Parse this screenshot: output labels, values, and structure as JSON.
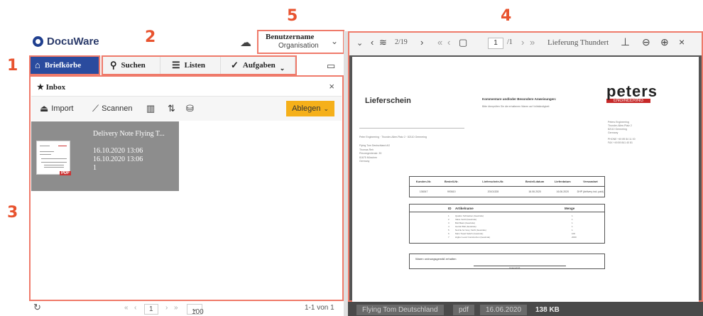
{
  "callouts": [
    "1",
    "2",
    "3",
    "4",
    "5"
  ],
  "app": {
    "logo_text": "DocuWare"
  },
  "user": {
    "name": "Benutzername",
    "org": "Organisation"
  },
  "nav": [
    {
      "label": "Briefkörbe",
      "icon": "inbox-tray-icon"
    },
    {
      "label": "Suchen",
      "icon": "search-icon"
    },
    {
      "label": "Listen",
      "icon": "list-icon"
    },
    {
      "label": "Aufgaben",
      "icon": "check-icon"
    }
  ],
  "inbox": {
    "title": "Inbox",
    "toolbar": {
      "import": "Import",
      "scan": "Scannen",
      "file_button": "Ablegen"
    },
    "card": {
      "title": "Delivery Note Flying T...",
      "date1": "16.10.2020 13:06",
      "date2": "16.10.2020 13:06",
      "count": "1",
      "badge": "PDF"
    }
  },
  "pager": {
    "page": "1",
    "per_page": "100",
    "range": "1-1 von 1"
  },
  "viewer": {
    "doc_index": "2/19",
    "page": "1",
    "page_total": "/1",
    "doc_title": "Lieferung Thundert",
    "document": {
      "heading": "Lieferschein",
      "comments": "Kommentare und/oder Besondere Anweisungen:",
      "comments_sub": "Bitte überprüfen Sie die erhaltenen Waren auf Vollständigkeit",
      "brand": "peters",
      "brand_sub": "ENGINEERING",
      "sender_line": "Peter Engineering · Thunder-Allee-Platz 2 · 82110 Germering",
      "recipient": [
        "Flying Tom Deutschland AG",
        "Thomas Reh",
        "Prinzregentenstr. 39",
        "81675 München",
        "Germany"
      ],
      "company": [
        "Peters Engineering",
        "Thunder-Allee-Platz 2",
        "82110 Germering",
        "Germany"
      ],
      "contact": [
        "PHONE  +49 89 84 11 00",
        "FAX    +49 89 841 40 81"
      ],
      "table1_headers": [
        "Kunden-Nr.",
        "Bestell-Nr.",
        "Lieferschein-Nr.",
        "Bestell-datum",
        "Lieferdatum",
        "Versandart"
      ],
      "table1_row": [
        "136347",
        "993610",
        "20101328",
        "16.06.2020",
        "16.06.2020",
        "DHP (delivery incl. paid)"
      ],
      "table2_headers": [
        "ID",
        "Artikelname",
        "Menge"
      ],
      "table2_rows": [
        [
          "1",
          "Quattro Schrauben (Gewinde)",
          "1"
        ],
        [
          "2",
          "Valve Ventil (Gewinde)",
          "1"
        ],
        [
          "3",
          "Bolt Basic (Gewinde)",
          "1"
        ],
        [
          "4",
          "Gerüst Bolt (Gewinde)",
          "1"
        ],
        [
          "5",
          "Nozzle for Grey Yacht (Gewinde)",
          "1"
        ],
        [
          "6",
          "Main Tread Switch (Gewinde)",
          "100"
        ],
        [
          "7",
          "Higher Level Construction (Gewinde)",
          "2000"
        ]
      ],
      "received": "Waren ordnungsgemäß erhalten",
      "signature": "Unterschrift"
    },
    "status": [
      "Flying Tom Deutschland",
      "pdf",
      "16.06.2020",
      "138 KB"
    ]
  }
}
